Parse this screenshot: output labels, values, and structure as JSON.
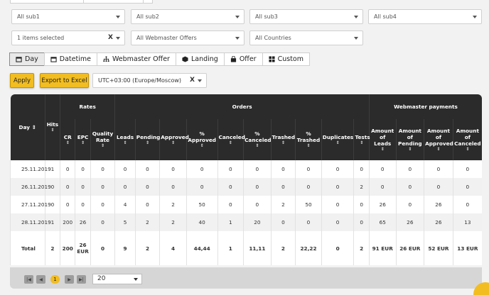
{
  "filters": {
    "sub1": "All sub1",
    "sub2": "All sub2",
    "sub3": "All sub3",
    "sub4": "All sub4",
    "items": "1 items selected",
    "offers": "All Webmaster Offers",
    "countries": "All Countries",
    "clear": "X"
  },
  "groupby": [
    {
      "label": "Day",
      "icon": "calendar-icon",
      "active": true
    },
    {
      "label": "Datetime",
      "icon": "calendar-icon",
      "active": false
    },
    {
      "label": "Webmaster Offer",
      "icon": "sitemap-icon",
      "active": false
    },
    {
      "label": "Landing",
      "icon": "cube-icon",
      "active": false
    },
    {
      "label": "Offer",
      "icon": "bag-icon",
      "active": false
    },
    {
      "label": "Custom",
      "icon": "grid-icon",
      "active": false
    }
  ],
  "actions": {
    "apply": "Apply",
    "export": "Export to Excel",
    "timezone": "UTC+03:00 (Europe/Moscow)",
    "tz_clear": "X"
  },
  "table": {
    "groups": {
      "rates": "Rates",
      "orders": "Orders",
      "payments": "Webmaster payments"
    },
    "sort": "⇕",
    "headers": {
      "day": "Day",
      "hits": "Hits",
      "cr": "CR",
      "epc": "EPC",
      "quality": "Quality Rate",
      "leads": "Leads",
      "pending": "Pending",
      "approved": "Approved",
      "p_approved": "% Approved",
      "canceled": "Canceled",
      "p_canceled": "% Canceled",
      "trashed": "Trashed",
      "p_trashed": "% Trashed",
      "duplicates": "Duplicates",
      "tests": "Tests",
      "amt_leads": "Amount of Leads",
      "amt_pending": "Amount of Pending",
      "amt_approved": "Amount of Approved",
      "amt_canceled": "Amount of Canceled"
    },
    "rows": [
      [
        "25.11.2019",
        "1",
        "0",
        "0",
        "0",
        "0",
        "0",
        "0",
        "0",
        "0",
        "0",
        "0",
        "0",
        "0",
        "0",
        "0",
        "0",
        "0",
        "0"
      ],
      [
        "26.11.2019",
        "0",
        "0",
        "0",
        "0",
        "0",
        "0",
        "0",
        "0",
        "0",
        "0",
        "0",
        "0",
        "0",
        "2",
        "0",
        "0",
        "0",
        "0"
      ],
      [
        "27.11.2019",
        "0",
        "0",
        "0",
        "0",
        "4",
        "0",
        "2",
        "50",
        "0",
        "0",
        "2",
        "50",
        "0",
        "0",
        "26",
        "0",
        "26",
        "0"
      ],
      [
        "28.11.2019",
        "1",
        "200",
        "26",
        "0",
        "5",
        "2",
        "2",
        "40",
        "1",
        "20",
        "0",
        "0",
        "0",
        "0",
        "65",
        "26",
        "26",
        "13"
      ]
    ],
    "total": [
      "Total",
      "2",
      "200",
      "26 EUR",
      "0",
      "9",
      "2",
      "4",
      "44,44",
      "1",
      "11,11",
      "2",
      "22,22",
      "0",
      "2",
      "91 EUR",
      "26 EUR",
      "52 EUR",
      "13 EUR"
    ]
  },
  "pager": {
    "first": "|◀",
    "prev": "◀",
    "page": "1",
    "next": "▶",
    "last": "▶|",
    "per_page": "20"
  }
}
